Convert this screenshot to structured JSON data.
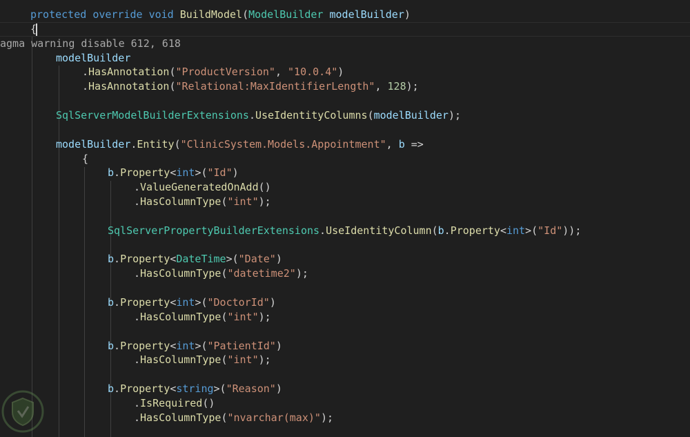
{
  "theme": {
    "background": "#1f1f1f",
    "keyword": "#569cd6",
    "type": "#4ec9b0",
    "method": "#dcdcaa",
    "variable": "#9cdcfe",
    "string": "#ce9178",
    "number": "#b5cea8",
    "plain": "#d4d4d4",
    "pragma": "#a9a9a9"
  },
  "code": {
    "lines": [
      [
        [
          "keyword",
          "protected"
        ],
        [
          "plain",
          " "
        ],
        [
          "keyword",
          "override"
        ],
        [
          "plain",
          " "
        ],
        [
          "keyword",
          "void"
        ],
        [
          "plain",
          " "
        ],
        [
          "method",
          "BuildModel"
        ],
        [
          "plain",
          "("
        ],
        [
          "type",
          "ModelBuilder"
        ],
        [
          "plain",
          " "
        ],
        [
          "param",
          "modelBuilder"
        ],
        [
          "plain",
          ")"
        ]
      ],
      [
        [
          "plain",
          "{"
        ]
      ],
      [
        [
          "pragma",
          "agma warning disable 612, 618"
        ]
      ],
      [
        [
          "var",
          "modelBuilder"
        ]
      ],
      [
        [
          "plain",
          "."
        ],
        [
          "method",
          "HasAnnotation"
        ],
        [
          "plain",
          "("
        ],
        [
          "string",
          "\"ProductVersion\""
        ],
        [
          "plain",
          ", "
        ],
        [
          "string",
          "\"10.0.4\""
        ],
        [
          "plain",
          ")"
        ]
      ],
      [
        [
          "plain",
          "."
        ],
        [
          "method",
          "HasAnnotation"
        ],
        [
          "plain",
          "("
        ],
        [
          "string",
          "\"Relational:MaxIdentifierLength\""
        ],
        [
          "plain",
          ", "
        ],
        [
          "number",
          "128"
        ],
        [
          "plain",
          ");"
        ]
      ],
      [],
      [
        [
          "type",
          "SqlServerModelBuilderExtensions"
        ],
        [
          "plain",
          "."
        ],
        [
          "method",
          "UseIdentityColumns"
        ],
        [
          "plain",
          "("
        ],
        [
          "var",
          "modelBuilder"
        ],
        [
          "plain",
          ");"
        ]
      ],
      [],
      [
        [
          "var",
          "modelBuilder"
        ],
        [
          "plain",
          "."
        ],
        [
          "method",
          "Entity"
        ],
        [
          "plain",
          "("
        ],
        [
          "string",
          "\"ClinicSystem.Models.Appointment\""
        ],
        [
          "plain",
          ", "
        ],
        [
          "param",
          "b"
        ],
        [
          "plain",
          " =>"
        ]
      ],
      [
        [
          "plain",
          "{"
        ]
      ],
      [
        [
          "var",
          "b"
        ],
        [
          "plain",
          "."
        ],
        [
          "method",
          "Property"
        ],
        [
          "plain",
          "<"
        ],
        [
          "keyword",
          "int"
        ],
        [
          "plain",
          ">("
        ],
        [
          "string",
          "\"Id\""
        ],
        [
          "plain",
          ")"
        ]
      ],
      [
        [
          "plain",
          "."
        ],
        [
          "method",
          "ValueGeneratedOnAdd"
        ],
        [
          "plain",
          "()"
        ]
      ],
      [
        [
          "plain",
          "."
        ],
        [
          "method",
          "HasColumnType"
        ],
        [
          "plain",
          "("
        ],
        [
          "string",
          "\"int\""
        ],
        [
          "plain",
          ");"
        ]
      ],
      [],
      [
        [
          "type",
          "SqlServerPropertyBuilderExtensions"
        ],
        [
          "plain",
          "."
        ],
        [
          "method",
          "UseIdentityColumn"
        ],
        [
          "plain",
          "("
        ],
        [
          "var",
          "b"
        ],
        [
          "plain",
          "."
        ],
        [
          "method",
          "Property"
        ],
        [
          "plain",
          "<"
        ],
        [
          "keyword",
          "int"
        ],
        [
          "plain",
          ">("
        ],
        [
          "string",
          "\"Id\""
        ],
        [
          "plain",
          "));"
        ]
      ],
      [],
      [
        [
          "var",
          "b"
        ],
        [
          "plain",
          "."
        ],
        [
          "method",
          "Property"
        ],
        [
          "plain",
          "<"
        ],
        [
          "type",
          "DateTime"
        ],
        [
          "plain",
          ">("
        ],
        [
          "string",
          "\"Date\""
        ],
        [
          "plain",
          ")"
        ]
      ],
      [
        [
          "plain",
          "."
        ],
        [
          "method",
          "HasColumnType"
        ],
        [
          "plain",
          "("
        ],
        [
          "string",
          "\"datetime2\""
        ],
        [
          "plain",
          ");"
        ]
      ],
      [],
      [
        [
          "var",
          "b"
        ],
        [
          "plain",
          "."
        ],
        [
          "method",
          "Property"
        ],
        [
          "plain",
          "<"
        ],
        [
          "keyword",
          "int"
        ],
        [
          "plain",
          ">("
        ],
        [
          "string",
          "\"DoctorId\""
        ],
        [
          "plain",
          ")"
        ]
      ],
      [
        [
          "plain",
          "."
        ],
        [
          "method",
          "HasColumnType"
        ],
        [
          "plain",
          "("
        ],
        [
          "string",
          "\"int\""
        ],
        [
          "plain",
          ");"
        ]
      ],
      [],
      [
        [
          "var",
          "b"
        ],
        [
          "plain",
          "."
        ],
        [
          "method",
          "Property"
        ],
        [
          "plain",
          "<"
        ],
        [
          "keyword",
          "int"
        ],
        [
          "plain",
          ">("
        ],
        [
          "string",
          "\"PatientId\""
        ],
        [
          "plain",
          ")"
        ]
      ],
      [
        [
          "plain",
          "."
        ],
        [
          "method",
          "HasColumnType"
        ],
        [
          "plain",
          "("
        ],
        [
          "string",
          "\"int\""
        ],
        [
          "plain",
          ");"
        ]
      ],
      [],
      [
        [
          "var",
          "b"
        ],
        [
          "plain",
          "."
        ],
        [
          "method",
          "Property"
        ],
        [
          "plain",
          "<"
        ],
        [
          "keyword",
          "string"
        ],
        [
          "plain",
          ">("
        ],
        [
          "string",
          "\"Reason\""
        ],
        [
          "plain",
          ")"
        ]
      ],
      [
        [
          "plain",
          "."
        ],
        [
          "method",
          "IsRequired"
        ],
        [
          "plain",
          "()"
        ]
      ],
      [
        [
          "plain",
          "."
        ],
        [
          "method",
          "HasColumnType"
        ],
        [
          "plain",
          "("
        ],
        [
          "string",
          "\"nvarchar(max)\""
        ],
        [
          "plain",
          ");"
        ]
      ]
    ]
  },
  "watermark": {
    "icon": "shield-logo-icon"
  }
}
